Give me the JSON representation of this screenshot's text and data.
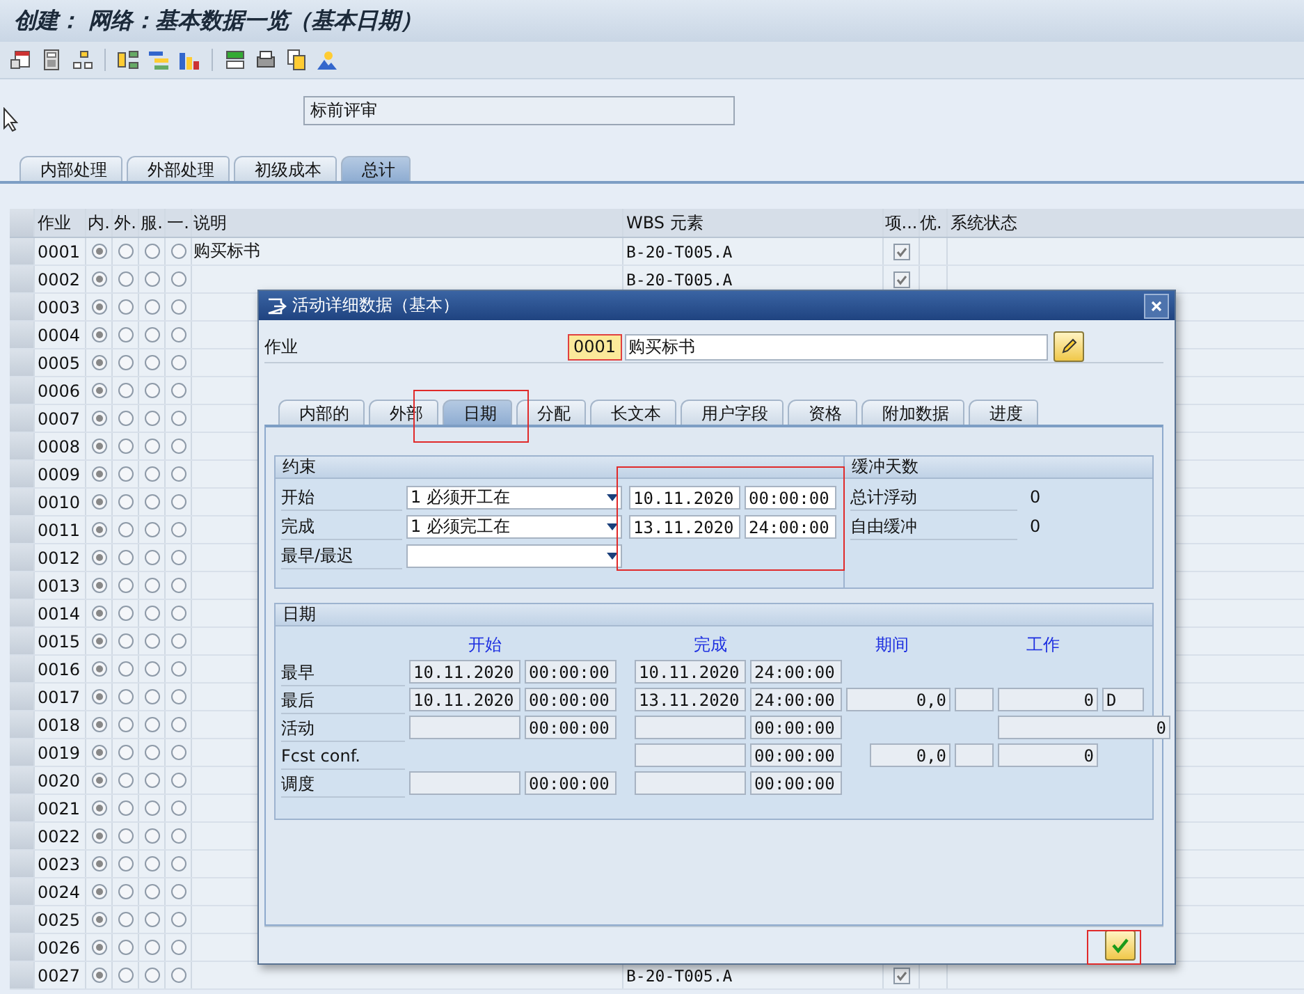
{
  "window": {
    "title": "创建： 网络：基本数据一览（基本日期）"
  },
  "header_field": {
    "value": "标前评审"
  },
  "tabs": [
    {
      "label": "内部处理",
      "selected": false
    },
    {
      "label": "外部处理",
      "selected": false
    },
    {
      "label": "初级成本",
      "selected": false
    },
    {
      "label": "总计",
      "selected": true
    }
  ],
  "table": {
    "columns": [
      "作业",
      "内.",
      "外.",
      "服.",
      "一.",
      "说明",
      "WBS 元素",
      "项...",
      "优.",
      "系统状态"
    ],
    "rows": [
      {
        "activity": "0001",
        "radios": [
          true,
          false,
          false,
          false
        ],
        "description": "购买标书",
        "wbs": "B-20-T005.A",
        "checked": true
      },
      {
        "activity": "0002",
        "radios": [
          true,
          false,
          false,
          false
        ],
        "wbs": "B-20-T005.A",
        "checked": true
      },
      {
        "activity": "0003",
        "radios": [
          true,
          false,
          false,
          false
        ]
      },
      {
        "activity": "0004",
        "radios": [
          true,
          false,
          false,
          false
        ]
      },
      {
        "activity": "0005",
        "radios": [
          true,
          false,
          false,
          false
        ]
      },
      {
        "activity": "0006",
        "radios": [
          true,
          false,
          false,
          false
        ]
      },
      {
        "activity": "0007",
        "radios": [
          true,
          false,
          false,
          false
        ]
      },
      {
        "activity": "0008",
        "radios": [
          true,
          false,
          false,
          false
        ]
      },
      {
        "activity": "0009",
        "radios": [
          true,
          false,
          false,
          false
        ]
      },
      {
        "activity": "0010",
        "radios": [
          true,
          false,
          false,
          false
        ]
      },
      {
        "activity": "0011",
        "radios": [
          true,
          false,
          false,
          false
        ]
      },
      {
        "activity": "0012",
        "radios": [
          true,
          false,
          false,
          false
        ]
      },
      {
        "activity": "0013",
        "radios": [
          true,
          false,
          false,
          false
        ]
      },
      {
        "activity": "0014",
        "radios": [
          true,
          false,
          false,
          false
        ]
      },
      {
        "activity": "0015",
        "radios": [
          true,
          false,
          false,
          false
        ]
      },
      {
        "activity": "0016",
        "radios": [
          true,
          false,
          false,
          false
        ]
      },
      {
        "activity": "0017",
        "radios": [
          true,
          false,
          false,
          false
        ]
      },
      {
        "activity": "0018",
        "radios": [
          true,
          false,
          false,
          false
        ]
      },
      {
        "activity": "0019",
        "radios": [
          true,
          false,
          false,
          false
        ]
      },
      {
        "activity": "0020",
        "radios": [
          true,
          false,
          false,
          false
        ]
      },
      {
        "activity": "0021",
        "radios": [
          true,
          false,
          false,
          false
        ]
      },
      {
        "activity": "0022",
        "radios": [
          true,
          false,
          false,
          false
        ]
      },
      {
        "activity": "0023",
        "radios": [
          true,
          false,
          false,
          false
        ]
      },
      {
        "activity": "0024",
        "radios": [
          true,
          false,
          false,
          false
        ]
      },
      {
        "activity": "0025",
        "radios": [
          true,
          false,
          false,
          false
        ]
      },
      {
        "activity": "0026",
        "radios": [
          true,
          false,
          false,
          false
        ]
      },
      {
        "activity": "0027",
        "radios": [
          true,
          false,
          false,
          false
        ],
        "wbs": "B-20-T005.A",
        "checked": true
      }
    ]
  },
  "dialog": {
    "title": "活动详细数据（基本）",
    "activity_label": "作业",
    "activity_number": "0001",
    "activity_text": "购买标书",
    "tabs": [
      {
        "label": "内部的",
        "selected": false
      },
      {
        "label": "外部",
        "selected": false
      },
      {
        "label": "日期",
        "selected": true
      },
      {
        "label": "分配",
        "selected": false
      },
      {
        "label": "长文本",
        "selected": false
      },
      {
        "label": "用户字段",
        "selected": false
      },
      {
        "label": "资格",
        "selected": false
      },
      {
        "label": "附加数据",
        "selected": false
      },
      {
        "label": "进度",
        "selected": false
      }
    ],
    "constraints": {
      "title": "约束",
      "rows": [
        {
          "label": "开始",
          "option": "1 必须开工在",
          "date": "10.11.2020",
          "time": "00:00:00"
        },
        {
          "label": "完成",
          "option": "1 必须完工在",
          "date": "13.11.2020",
          "time": "24:00:00"
        },
        {
          "label": "最早/最迟"
        }
      ]
    },
    "buffer": {
      "title": "缓冲天数",
      "rows": [
        {
          "label": "总计浮动",
          "value": "0"
        },
        {
          "label": "自由缓冲",
          "value": "0"
        }
      ]
    },
    "dates": {
      "title": "日期",
      "headers": [
        {
          "kind": "start",
          "label": "开始"
        },
        {
          "kind": "end",
          "label": "完成"
        },
        {
          "kind": "duration",
          "label": "期间"
        },
        {
          "kind": "work",
          "label": "工作"
        }
      ],
      "rows": [
        {
          "label": "最早",
          "fields": [
            {
              "kind": "sdate",
              "value": "10.11.2020"
            },
            {
              "kind": "stime",
              "value": "00:00:00"
            },
            {
              "kind": "edate",
              "value": "10.11.2020"
            },
            {
              "kind": "etime",
              "value": "24:00:00"
            }
          ]
        },
        {
          "label": "最后",
          "fields": [
            {
              "kind": "sdate",
              "value": "10.11.2020"
            },
            {
              "kind": "stime",
              "value": "00:00:00"
            },
            {
              "kind": "edate",
              "value": "13.11.2020"
            },
            {
              "kind": "etime",
              "value": "24:00:00"
            },
            {
              "kind": "durwide",
              "value": "0,0"
            },
            {
              "kind": "durunit"
            },
            {
              "kind": "work",
              "value": "0"
            },
            {
              "kind": "workunit",
              "value": "D"
            }
          ]
        },
        {
          "label": "活动",
          "fields": [
            {
              "kind": "sdate"
            },
            {
              "kind": "stime",
              "value": "00:00:00"
            },
            {
              "kind": "edate"
            },
            {
              "kind": "etime",
              "value": "00:00:00"
            },
            {
              "kind": "workwide",
              "value": "0"
            }
          ]
        },
        {
          "label": "Fcst conf.",
          "fields": [
            {
              "kind": "edate"
            },
            {
              "kind": "etime",
              "value": "00:00:00"
            },
            {
              "kind": "duration",
              "value": "0,0"
            },
            {
              "kind": "durunit"
            },
            {
              "kind": "work",
              "value": "0"
            }
          ]
        },
        {
          "label": "调度",
          "fields": [
            {
              "kind": "sdate"
            },
            {
              "kind": "stime",
              "value": "00:00:00"
            },
            {
              "kind": "edate"
            },
            {
              "kind": "etime",
              "value": "00:00:00"
            }
          ]
        }
      ]
    }
  }
}
